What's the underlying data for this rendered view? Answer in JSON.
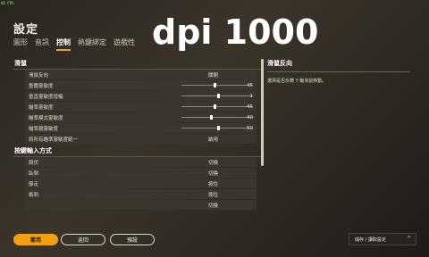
{
  "fps": "60 FPS",
  "title": "設定",
  "overlay_text": "dpi 1000",
  "tabs": [
    "圖形",
    "音訊",
    "控制",
    "熱鍵綁定",
    "遊戲性"
  ],
  "active_tab": "控制",
  "sections": {
    "mouse": {
      "heading": "滑鼠",
      "rows": [
        {
          "label": "滑鼠反向",
          "value": "關閉"
        },
        {
          "label": "整體靈敏度",
          "slider": 0.45,
          "number": "45"
        },
        {
          "label": "垂直靈敏度增幅",
          "slider": 0.5,
          "number": "1"
        },
        {
          "label": "瞄準靈敏度",
          "slider": 0.45,
          "number": "45"
        },
        {
          "label": "瞄準模式靈敏度",
          "slider": 0.4,
          "number": "40"
        },
        {
          "label": "瞄準鏡靈敏度",
          "slider": 0.5,
          "number": "50"
        },
        {
          "label": "將所有瞄準靈敏度統一",
          "value": "啟用"
        }
      ]
    },
    "keys": {
      "heading": "按鍵輸入方式",
      "rows": [
        {
          "label": "蹲伏",
          "value": "切換"
        },
        {
          "label": "臥倒",
          "value": "切換"
        },
        {
          "label": "靜走",
          "value": "按住"
        },
        {
          "label": "衝刺",
          "value": "按住"
        },
        {
          "label": "",
          "value": "切換"
        }
      ]
    }
  },
  "side": {
    "title": "滑鼠反向",
    "text": "選擇是否反轉 Y 軸滑鼠移動。"
  },
  "footer": {
    "apply": "套用",
    "back": "返回",
    "default": "預設",
    "preset": "儲存 / 讀取設定"
  }
}
